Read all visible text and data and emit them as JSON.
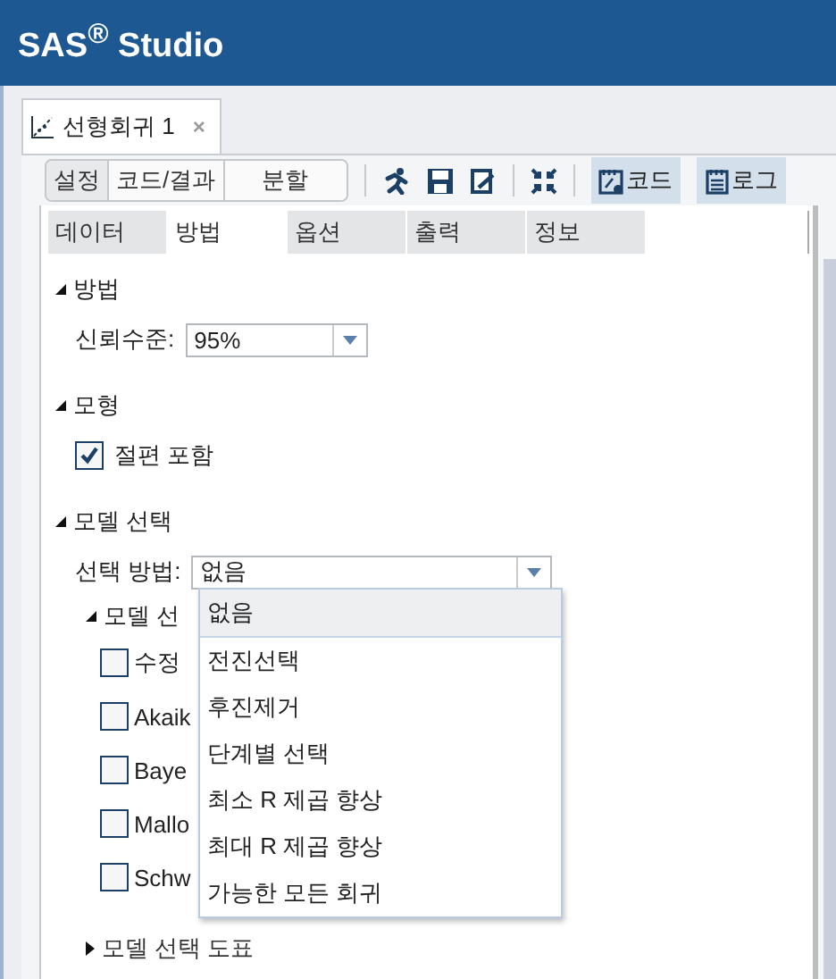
{
  "app": {
    "title": "SAS$^{®}$ Studio"
  },
  "document_tab": {
    "label": "선형회귀 1",
    "close": "×"
  },
  "view_buttons": [
    {
      "label": "설정",
      "selected": true
    },
    {
      "label": "코드/결과",
      "selected": false
    },
    {
      "label": "분할",
      "selected": false
    }
  ],
  "toggles": [
    {
      "kind": "code",
      "label": "코드",
      "on": true
    },
    {
      "kind": "log",
      "label": "로그",
      "on": true
    }
  ],
  "subtabs": [
    {
      "label": "데이터",
      "selected": false
    },
    {
      "label": "방법",
      "selected": true
    },
    {
      "label": "옵션",
      "selected": false
    },
    {
      "label": "출력",
      "selected": false
    },
    {
      "label": "정보",
      "selected": false
    }
  ],
  "method": {
    "title": "방법",
    "expanded": true,
    "confidence_label": "신뢰수준:",
    "confidence_value": "95%"
  },
  "model": {
    "title": "모형",
    "expanded": true,
    "intercept": {
      "label": "절편 포함",
      "checked": true
    }
  },
  "selection": {
    "title": "모델 선택",
    "expanded": true,
    "method_label": "선택 방법:",
    "method_value": "없음",
    "options": [
      {
        "label": "없음",
        "selected": true
      },
      {
        "label": "전진선택",
        "selected": false
      },
      {
        "label": "후진제거",
        "selected": false
      },
      {
        "label": "단계별 선택",
        "selected": false
      },
      {
        "label": "최소 R 제곱 향상",
        "selected": false
      },
      {
        "label": "최대 R 제곱 향상",
        "selected": false
      },
      {
        "label": "가능한 모든 회귀",
        "selected": false
      }
    ],
    "criteria": {
      "title": "모델 선",
      "expanded": true,
      "items": [
        {
          "label": "수정",
          "checked": false
        },
        {
          "label": "Akaik",
          "checked": false
        },
        {
          "label": "Baye",
          "checked": false
        },
        {
          "label": "Mallo",
          "checked": false
        },
        {
          "label": "Schw",
          "checked": false
        }
      ]
    },
    "plots": {
      "title": "모델 선택 도표",
      "expanded": false
    }
  }
}
